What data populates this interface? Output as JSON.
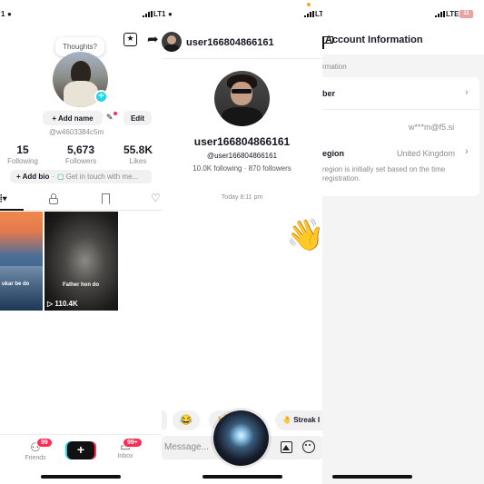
{
  "profile_screen": {
    "status": {
      "time_fragment": "1",
      "carrier": "LT"
    },
    "thought_bubble": "Thoughts?",
    "add_name_label": "+ Add name",
    "edit_label": "Edit",
    "username": "@w4603384c5m",
    "stats": [
      {
        "value": "15",
        "label": "Following"
      },
      {
        "value": "5,673",
        "label": "Followers"
      },
      {
        "value": "55.8K",
        "label": "Likes"
      }
    ],
    "add_bio_label": "+ Add bio",
    "get_in_touch_label": "Get in touch with me...",
    "videos": [
      {
        "caption": "ukar be do",
        "views": ""
      },
      {
        "caption": "Father hon do",
        "views": "110.4K"
      }
    ],
    "bottom_nav": {
      "friends_label": "Friends",
      "friends_badge": "99",
      "inbox_label": "Inbox",
      "inbox_badge": "99+"
    }
  },
  "chat_screen": {
    "status": {
      "time_fragment": "1"
    },
    "header_username": "user166804866161",
    "display_name": "user166804866161",
    "handle": "@user166804866161",
    "follow_info": "10.0K following · 870 followers",
    "timestamp": "Today 8:11 pm",
    "quick_reactions": [
      {
        "emoji": "😂",
        "label": ""
      },
      {
        "emoji": "🤘",
        "label": ""
      },
      {
        "emoji": "🤚",
        "label": "Streak I"
      }
    ],
    "message_placeholder": "Message...",
    "wave_emoji": "👋"
  },
  "account_screen": {
    "status": {
      "carrier": "LTE",
      "battery": "11"
    },
    "title": "Account Information",
    "section_label": "rmation",
    "rows": [
      {
        "label": "ber",
        "value": ""
      },
      {
        "label": "",
        "value": "w***m@f5.si"
      },
      {
        "label": "egion",
        "value": "United Kingdom"
      }
    ],
    "region_note": "region is initially set based on the time registration."
  },
  "colors": {
    "accent": "#fe2c55",
    "cyan": "#20d5ec",
    "link_green": "#20b05c"
  }
}
